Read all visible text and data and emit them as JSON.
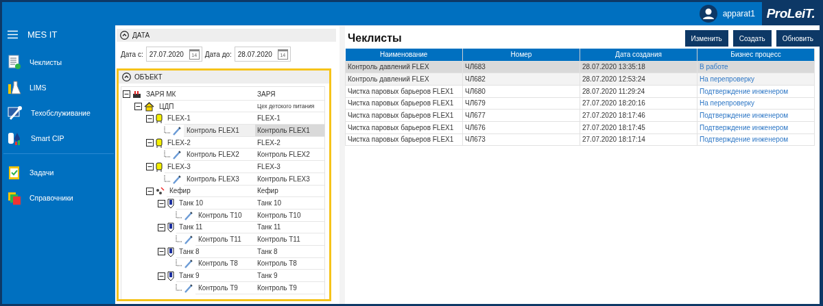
{
  "header": {
    "user": "apparat1",
    "logo": "ProLeiT."
  },
  "sidebar": {
    "title": "MES IT",
    "groups": [
      {
        "items": [
          {
            "label": "Чеклисты",
            "kind": "checklist"
          },
          {
            "label": "LIMS",
            "kind": "lab"
          },
          {
            "label": "Техобслуживание",
            "kind": "tools"
          },
          {
            "label": "Smart CIP",
            "kind": "cip"
          }
        ]
      },
      {
        "items": [
          {
            "label": "Задачи",
            "kind": "tasks"
          },
          {
            "label": "Справочники",
            "kind": "books"
          }
        ]
      }
    ]
  },
  "filters": {
    "date_section": {
      "title": "ДАТА",
      "expanded": true,
      "from_label": "Дата с:",
      "from": "27.07.2020",
      "to_label": "Дата до:",
      "to": "28.07.2020",
      "from_calendar_day": "14",
      "to_calendar_day": "14"
    },
    "object_section": {
      "title": "ОБЪЕКТ",
      "expanded": true,
      "tree": [
        {
          "name": "ЗАРЯ МК",
          "description": "ЗАРЯ",
          "kind": "factory",
          "expanded": true,
          "selected": false,
          "children": [
            {
              "name": "ЦДП",
              "description": "Цех детского питания",
              "kind": "house",
              "expanded": true,
              "selected": false,
              "children": [
                {
                  "name": "FLEX-1",
                  "description": "FLEX-1",
                  "kind": "flex",
                  "expanded": true,
                  "selected": false,
                  "children": [
                    {
                      "name": "Контроль FLEX1",
                      "description": "Контроль FLEX1",
                      "kind": "probe",
                      "selected": true
                    }
                  ]
                },
                {
                  "name": "FLEX-2",
                  "description": "FLEX-2",
                  "kind": "flex",
                  "expanded": true,
                  "selected": false,
                  "children": [
                    {
                      "name": "Контроль FLEX2",
                      "description": "Контроль FLEX2",
                      "kind": "probe",
                      "selected": false
                    }
                  ]
                },
                {
                  "name": "FLEX-3",
                  "description": "FLEX-3",
                  "kind": "flex",
                  "expanded": true,
                  "selected": false,
                  "children": [
                    {
                      "name": "Контроль FLEX3",
                      "description": "Контроль FLEX3",
                      "kind": "probe",
                      "selected": false
                    }
                  ]
                },
                {
                  "name": "Кефир",
                  "description": "Кефир",
                  "kind": "process",
                  "expanded": true,
                  "selected": false,
                  "children": [
                    {
                      "name": "Танк 10",
                      "description": "Танк 10",
                      "kind": "tank",
                      "expanded": true,
                      "selected": false,
                      "children": [
                        {
                          "name": "Контроль T10",
                          "description": "Контроль T10",
                          "kind": "probe",
                          "selected": false
                        }
                      ]
                    },
                    {
                      "name": "Танк 11",
                      "description": "Танк 11",
                      "kind": "tank",
                      "expanded": true,
                      "selected": false,
                      "children": [
                        {
                          "name": "Контроль T11",
                          "description": "Контроль T11",
                          "kind": "probe",
                          "selected": false
                        }
                      ]
                    },
                    {
                      "name": "Танк 8",
                      "description": "Танк 8",
                      "kind": "tank",
                      "expanded": true,
                      "selected": false,
                      "children": [
                        {
                          "name": "Контроль T8",
                          "description": "Контроль T8",
                          "kind": "probe",
                          "selected": false
                        }
                      ]
                    },
                    {
                      "name": "Танк 9",
                      "description": "Танк 9",
                      "kind": "tank",
                      "expanded": true,
                      "selected": false,
                      "children": [
                        {
                          "name": "Контроль T9",
                          "description": "Контроль T9",
                          "kind": "probe",
                          "selected": false
                        }
                      ]
                    }
                  ]
                }
              ]
            }
          ]
        }
      ]
    }
  },
  "checklists": {
    "title": "Чеклисты",
    "buttons": [
      "Изменить",
      "Создать",
      "Обновить"
    ],
    "table": {
      "columns": [
        "Наименование",
        "Номер",
        "Дата создания",
        "Бизнес процесс"
      ],
      "rows": [
        {
          "cells": [
            "Контроль давлений FLEX",
            "ЧЛ683",
            "28.07.2020 13:35:18",
            "В работе"
          ],
          "selected": true,
          "hovered": false
        },
        {
          "cells": [
            "Контроль давлений FLEX",
            "ЧЛ682",
            "28.07.2020 12:53:24",
            "На перепроверку"
          ],
          "selected": false,
          "hovered": true
        },
        {
          "cells": [
            "Чистка паровых барьеров FLEX1",
            "ЧЛ680",
            "28.07.2020 11:29:24",
            "Подтверждение инженером"
          ],
          "selected": false,
          "hovered": false
        },
        {
          "cells": [
            "Чистка паровых барьеров FLEX1",
            "ЧЛ679",
            "27.07.2020 18:20:16",
            "На перепроверку"
          ],
          "selected": false,
          "hovered": false
        },
        {
          "cells": [
            "Чистка паровых барьеров FLEX1",
            "ЧЛ677",
            "27.07.2020 18:17:46",
            "Подтверждение инженером"
          ],
          "selected": false,
          "hovered": false
        },
        {
          "cells": [
            "Чистка паровых барьеров FLEX1",
            "ЧЛ676",
            "27.07.2020 18:17:45",
            "Подтверждение инженером"
          ],
          "selected": false,
          "hovered": false
        },
        {
          "cells": [
            "Чистка паровых барьеров FLEX1",
            "ЧЛ673",
            "27.07.2020 18:17:14",
            "Подтверждение инженером"
          ],
          "selected": false,
          "hovered": false
        }
      ]
    }
  }
}
